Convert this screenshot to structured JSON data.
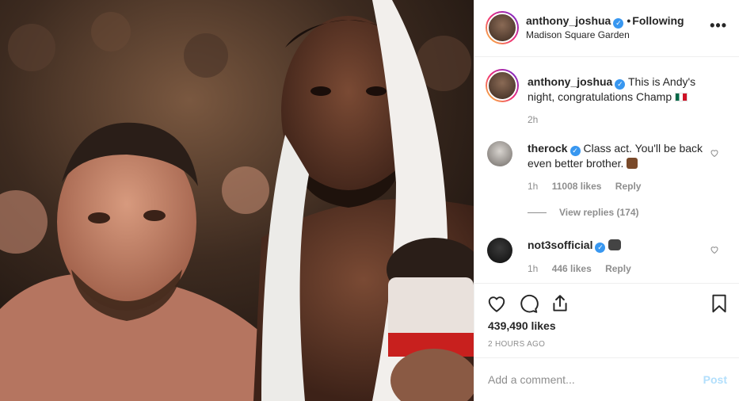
{
  "post": {
    "author": "anthony_joshua",
    "follow_status": "Following",
    "location": "Madison Square Garden",
    "more_label": "•••",
    "likes": "439,490 likes",
    "time_ago": "2 HOURS AGO",
    "photo_alt": "Boxers in the ring after the fight"
  },
  "caption": {
    "username": "anthony_joshua",
    "text": "This is Andy's night, congratulations Champ",
    "emoji": "mexico-flag",
    "age": "2h"
  },
  "comments": [
    {
      "username": "therock",
      "text": "Class act. You'll be back even better brother.",
      "emoji": "flexed-biceps",
      "age": "1h",
      "likes": "11008 likes",
      "reply_label": "Reply",
      "view_replies": "View replies (174)"
    },
    {
      "username": "not3sofficial",
      "text": "",
      "emoji": "gorilla",
      "age": "1h",
      "likes": "446 likes",
      "reply_label": "Reply"
    }
  ],
  "icons": {
    "like": "heart-icon",
    "comment": "comment-icon",
    "share": "share-icon",
    "save": "bookmark-icon",
    "verified": "verified-badge-icon"
  },
  "composer": {
    "placeholder": "Add a comment...",
    "post_label": "Post"
  },
  "colors": {
    "verified": "#3897f0",
    "muted": "#8e8e8e",
    "text": "#262626",
    "post_disabled": "#b2dffc"
  }
}
